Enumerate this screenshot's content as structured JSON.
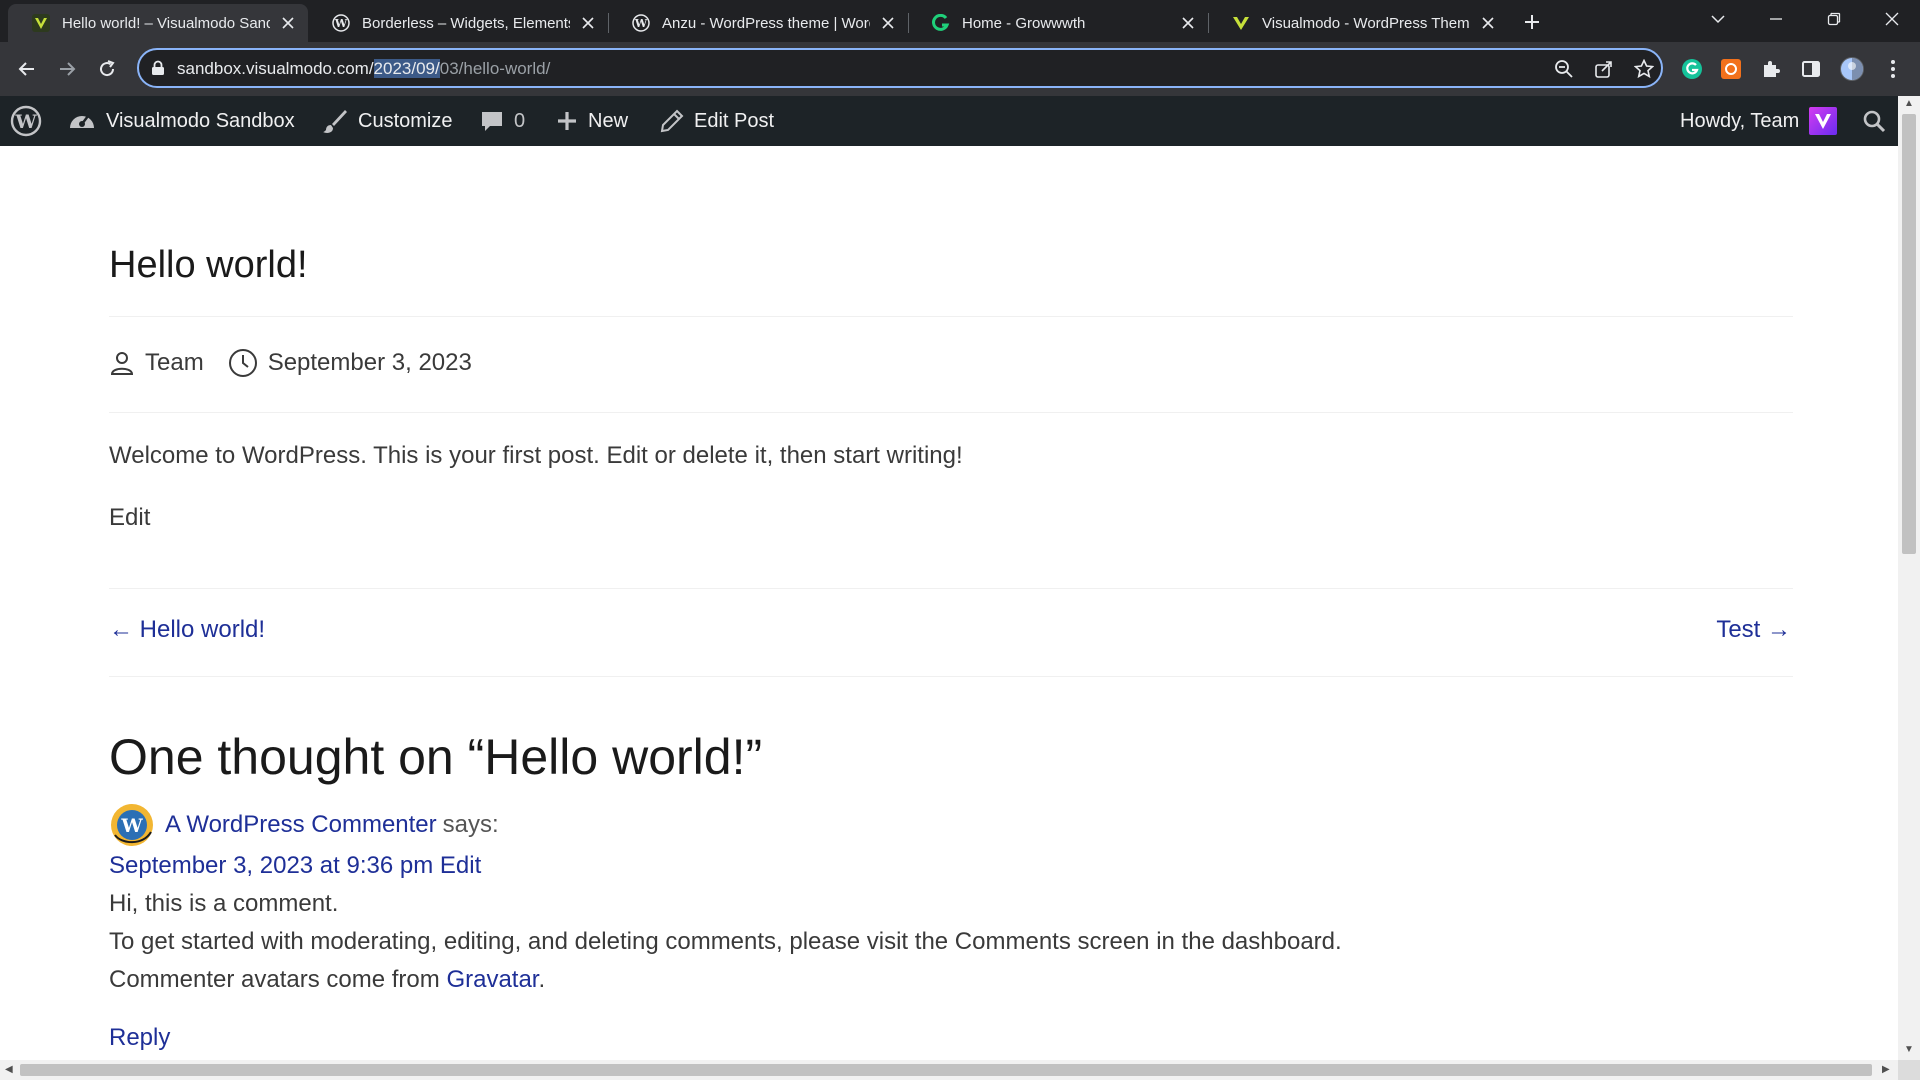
{
  "browser": {
    "tabs": [
      {
        "title": "Hello world! – Visualmodo Sandbox",
        "favicon": "visualmodo-v-icon",
        "active": true
      },
      {
        "title": "Borderless – Widgets, Elements, Templates",
        "favicon": "wordpress-icon",
        "active": false
      },
      {
        "title": "Anzu - WordPress theme | WordPress.org",
        "favicon": "wordpress-icon",
        "active": false
      },
      {
        "title": "Home - Growwwth",
        "favicon": "growwwth-g-icon",
        "active": false
      },
      {
        "title": "Visualmodo - WordPress Themes",
        "favicon": "visualmodo-v-icon",
        "active": false
      }
    ],
    "address": {
      "host": "sandbox.visualmodo.com/",
      "selected": "2023/09/",
      "rest": "03/hello-world/"
    },
    "colors": {
      "focus_ring": "#8ab4f8",
      "tab_bg": "#202124",
      "toolbar_bg": "#35363a"
    }
  },
  "adminbar": {
    "site_name": "Visualmodo Sandbox",
    "customize": "Customize",
    "comments_count": "0",
    "new": "New",
    "edit_post": "Edit Post",
    "howdy": "Howdy, Team",
    "color": "#1d2327"
  },
  "post": {
    "title": "Hello world!",
    "author": "Team",
    "date": "September 3, 2023",
    "body": "Welcome to WordPress. This is your first post. Edit or delete it, then start writing!",
    "edit": "Edit",
    "prev": "← Hello world!",
    "next": "Test →"
  },
  "comments": {
    "heading": "One thought on “Hello world!”",
    "author": "A WordPress Commenter",
    "says": "says:",
    "date": "September 3, 2023 at 9:36 pm",
    "edit": "Edit",
    "line1": "Hi, this is a comment.",
    "line2": "To get started with moderating, editing, and deleting comments, please visit the Comments screen in the dashboard.",
    "line3_prefix": "Commenter avatars come from ",
    "line3_link": "Gravatar",
    "line3_suffix": ".",
    "reply": "Reply",
    "link_color": "#1e2f97"
  }
}
